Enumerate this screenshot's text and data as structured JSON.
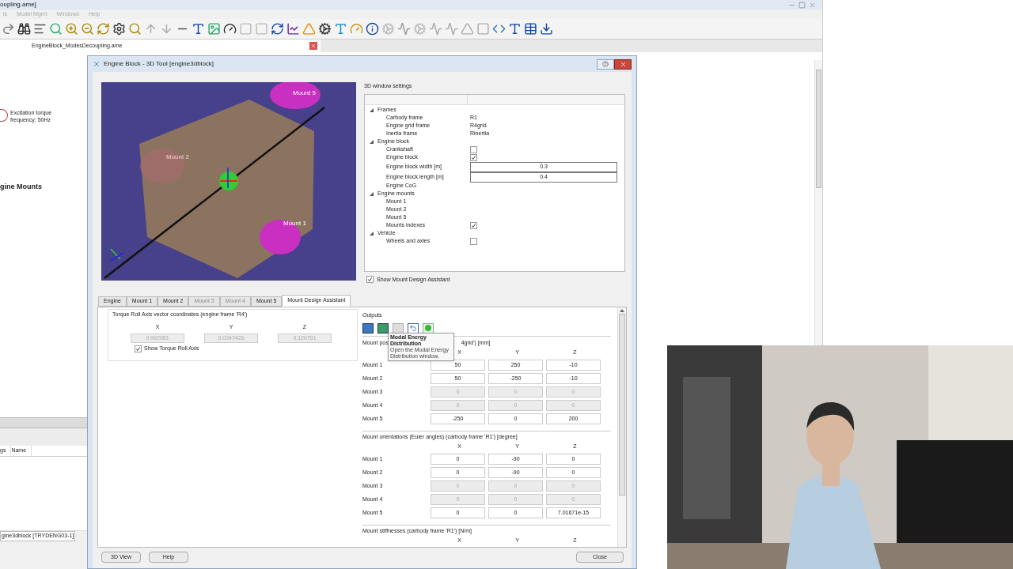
{
  "app": {
    "title": "oupling.ame]",
    "menu": [
      "ls",
      "Model Mgmt",
      "Windows",
      "Help"
    ],
    "document_tab": "EngineBlock_ModesDecoupling.ame"
  },
  "canvas": {
    "annotation": "Excitation torque\nfrequency: 50Hz",
    "heading": "gine Mounts"
  },
  "bottom_panel": {
    "columns": [
      "gs",
      "Name"
    ],
    "tab": "gine3dblock [TRYDENG03-1]"
  },
  "dialog": {
    "title": "Engine Block - 3D Tool [engine3dblock]",
    "view_labels": [
      {
        "text": "Mount 5",
        "faded": false
      },
      {
        "text": "Mount 2",
        "faded": true
      },
      {
        "text": "Mount 1",
        "faded": false
      }
    ],
    "settings": {
      "title": "3D window settings",
      "tree": [
        {
          "label": "Frames",
          "expanded": true,
          "children": [
            {
              "label": "Carbody frame",
              "kind": "text",
              "value": "R1"
            },
            {
              "label": "Engine grid frame",
              "kind": "text",
              "value": "R4grid"
            },
            {
              "label": "Inertia frame",
              "kind": "text",
              "value": "Rinertia"
            }
          ]
        },
        {
          "label": "Engine block",
          "expanded": true,
          "children": [
            {
              "label": "Crankshaft",
              "kind": "check",
              "checked": false
            },
            {
              "label": "Engine block",
              "kind": "check",
              "checked": true
            },
            {
              "label": "Engine block width [m]",
              "kind": "input",
              "value": "0.3"
            },
            {
              "label": "Engine block length [m]",
              "kind": "input",
              "value": "0.4"
            },
            {
              "label": "Engine CoG",
              "kind": "label"
            }
          ]
        },
        {
          "label": "Engine mounts",
          "expanded": true,
          "children": [
            {
              "label": "Mount 1",
              "kind": "label"
            },
            {
              "label": "Mount 2",
              "kind": "label"
            },
            {
              "label": "Mount 5",
              "kind": "label"
            },
            {
              "label": "Mounts indexes",
              "kind": "check",
              "checked": true
            }
          ]
        },
        {
          "label": "Vehicle",
          "expanded": true,
          "children": [
            {
              "label": "Wheels and axles",
              "kind": "check",
              "checked": false
            }
          ]
        }
      ],
      "assistant": {
        "label": "Show Mount Design Assistant",
        "checked": true
      }
    },
    "tabs": [
      {
        "label": "Engine",
        "selected": false,
        "disabled": false
      },
      {
        "label": "Mount 1",
        "selected": false,
        "disabled": false
      },
      {
        "label": "Mount 2",
        "selected": false,
        "disabled": false
      },
      {
        "label": "Mount 3",
        "selected": false,
        "disabled": true
      },
      {
        "label": "Mount 4",
        "selected": false,
        "disabled": true
      },
      {
        "label": "Mount 5",
        "selected": false,
        "disabled": false
      },
      {
        "label": "Mount Design Assistant",
        "selected": true,
        "disabled": false
      }
    ],
    "torque": {
      "title": "Torque Roll Axis vector coordinates (engine frame 'R4')",
      "axes": [
        "X",
        "Y",
        "Z"
      ],
      "values": [
        "0.992081",
        "0.0347426",
        "0.120701"
      ],
      "show": {
        "label": "Show Torque Roll Axis",
        "checked": true
      }
    },
    "outputs": {
      "title": "Outputs",
      "tooltip": {
        "title": "Modal Energy Distribution",
        "text": "Open the Modal Energy Distribution window."
      },
      "sections": [
        {
          "header": [
            "Mount pos",
            "4grid') [mm]"
          ],
          "axes": [
            "X",
            "Y",
            "Z"
          ],
          "rows": [
            {
              "label": "Mount 1",
              "disabled": false,
              "values": [
                "50",
                "250",
                "-10"
              ]
            },
            {
              "label": "Mount 2",
              "disabled": false,
              "values": [
                "50",
                "-250",
                "-10"
              ]
            },
            {
              "label": "Mount 3",
              "disabled": true,
              "values": [
                "0",
                "0",
                "0"
              ]
            },
            {
              "label": "Mount 4",
              "disabled": true,
              "values": [
                "0",
                "0",
                "0"
              ]
            },
            {
              "label": "Mount 5",
              "disabled": false,
              "values": [
                "-250",
                "0",
                "200"
              ]
            }
          ]
        },
        {
          "header": [
            "Mount orientations (Euler angles) (carbody frame 'R1') [degree]"
          ],
          "axes": [
            "X",
            "Y",
            "Z"
          ],
          "rows": [
            {
              "label": "Mount 1",
              "disabled": false,
              "values": [
                "0",
                "-90",
                "0"
              ]
            },
            {
              "label": "Mount 2",
              "disabled": false,
              "values": [
                "0",
                "-90",
                "0"
              ]
            },
            {
              "label": "Mount 3",
              "disabled": true,
              "values": [
                "0",
                "0",
                "0"
              ]
            },
            {
              "label": "Mount 4",
              "disabled": true,
              "values": [
                "0",
                "0",
                "0"
              ]
            },
            {
              "label": "Mount 5",
              "disabled": false,
              "values": [
                "0",
                "0",
                "7.01671e-15"
              ]
            }
          ]
        },
        {
          "header": [
            "Mount stiffnesses (carbody frame 'R1') [N/m]"
          ],
          "axes": [
            "X",
            "Y",
            "Z"
          ]
        }
      ]
    },
    "buttons": [
      "3D View",
      "Help"
    ],
    "close": "Close"
  }
}
